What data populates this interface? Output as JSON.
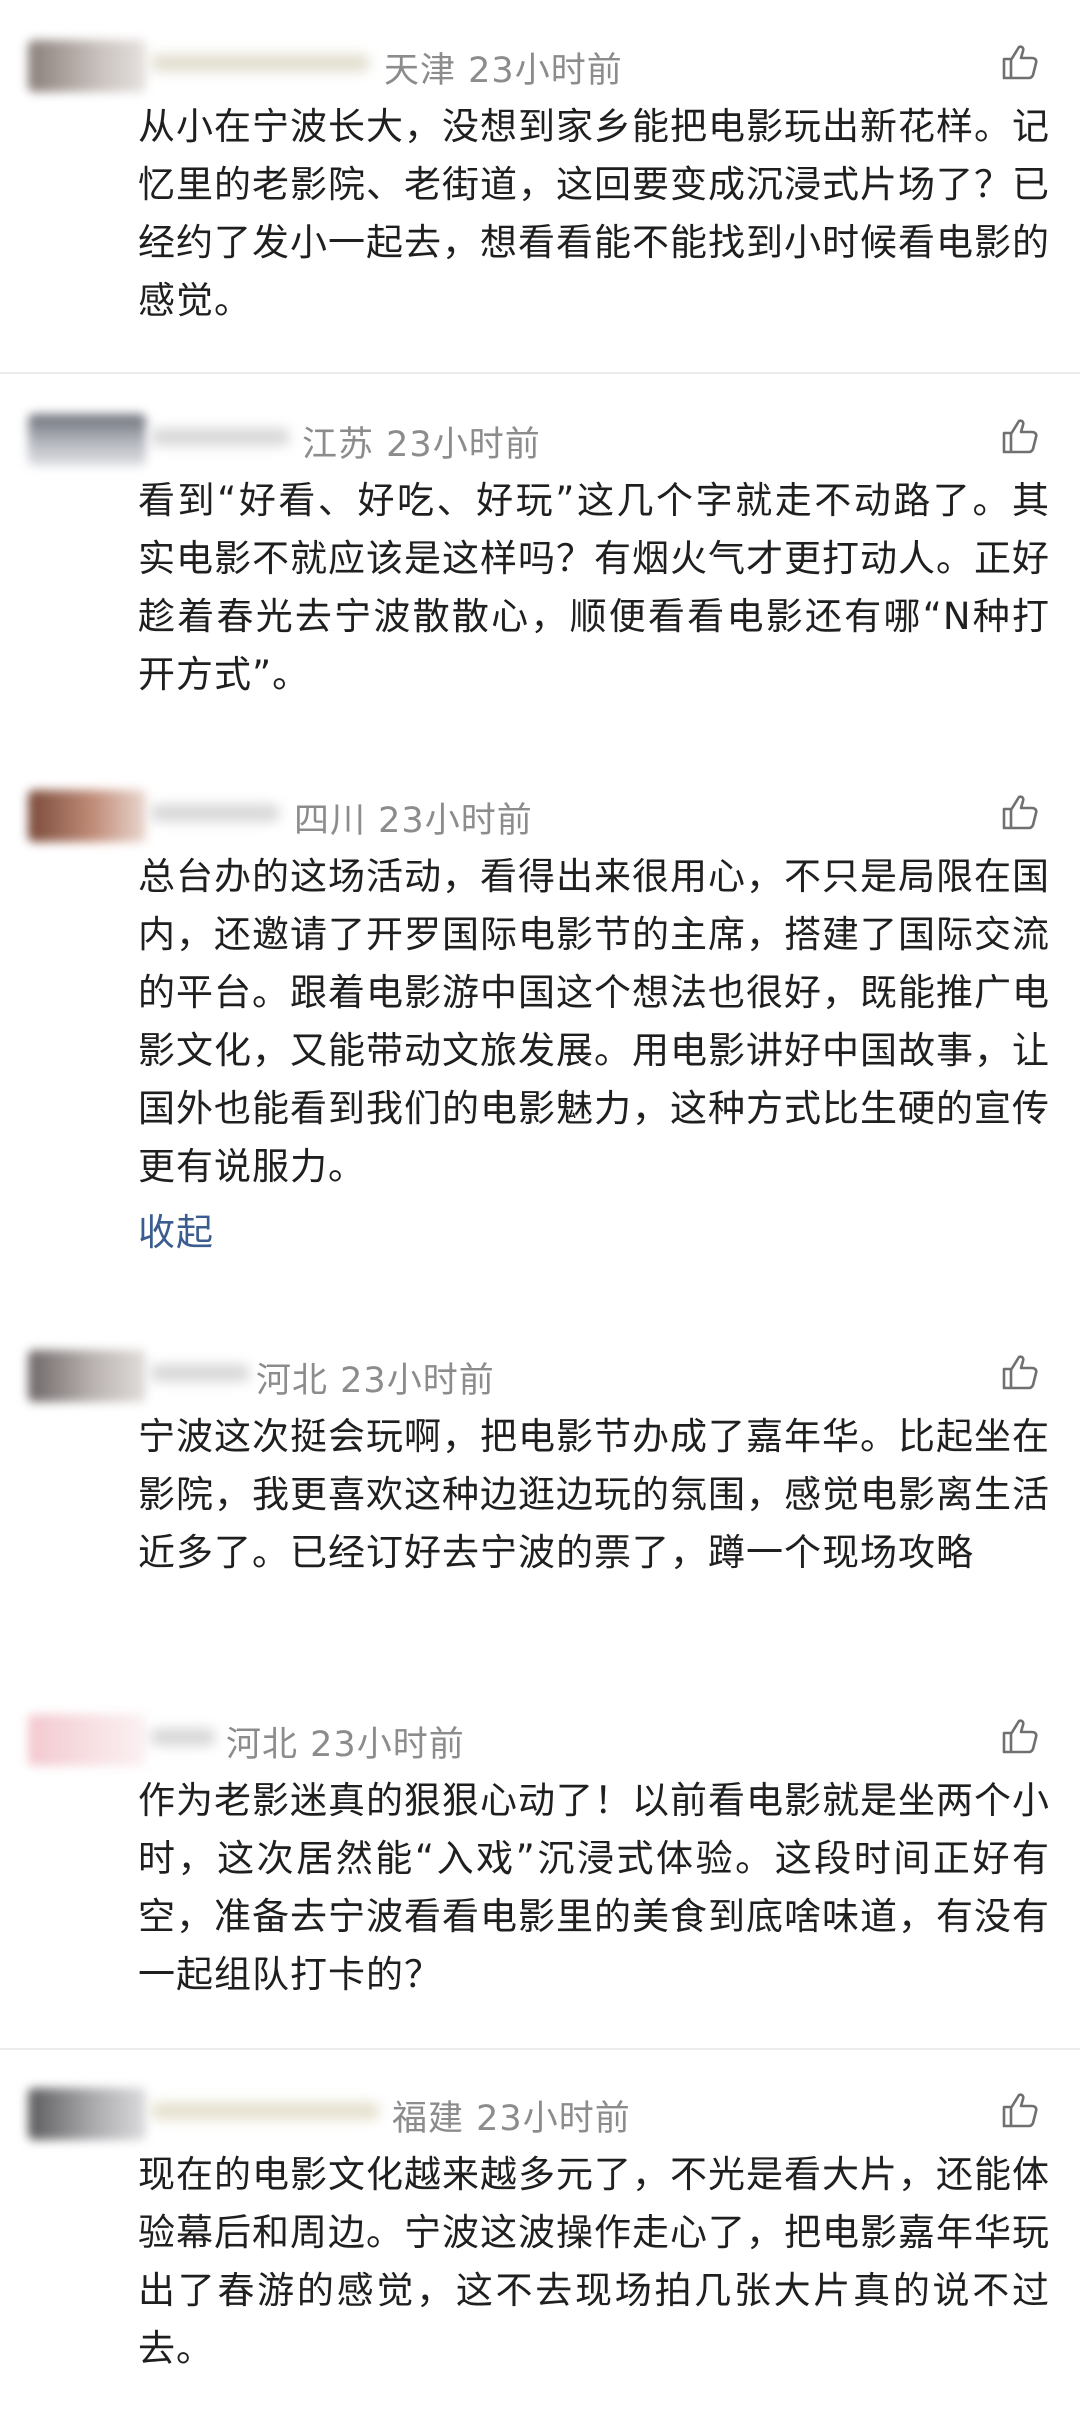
{
  "comments": [
    {
      "location": "天津",
      "time": "23小时前",
      "text": "从小在宁波长大，没想到家乡能把电影玩出新花样。记忆里的老影院、老街道，这回要变成沉浸式片场了？已经约了发小一起去，想看看能不能找到小时候看电影的感觉。"
    },
    {
      "location": "江苏",
      "time": "23小时前",
      "text": "看到“好看、好吃、好玩”这几个字就走不动路了。其实电影不就应该是这样吗？有烟火气才更打动人。正好趁着春光去宁波散散心，顺便看看电影还有哪“N种打开方式”。"
    },
    {
      "location": "四川",
      "time": "23小时前",
      "text": "总台办的这场活动，看得出来很用心，不只是局限在国内，还邀请了开罗国际电影节的主席，搭建了国际交流的平台。跟着电影游中国这个想法也很好，既能推广电影文化，又能带动文旅发展。用电影讲好中国故事，让国外也能看到我们的电影魅力，这种方式比生硬的宣传更有说服力。",
      "collapse_label": "收起"
    },
    {
      "location": "河北",
      "time": "23小时前",
      "text": "宁波这次挺会玩啊，把电影节办成了嘉年华。比起坐在影院，我更喜欢这种边逛边玩的氛围，感觉电影离生活近多了。已经订好去宁波的票了，蹲一个现场攻略"
    },
    {
      "location": "河北",
      "time": "23小时前",
      "text": "作为老影迷真的狠狠心动了！以前看电影就是坐两个小时，这次居然能“入戏”沉浸式体验。这段时间正好有空，准备去宁波看看电影里的美食到底啥味道，有没有一起组队打卡的？"
    },
    {
      "location": "福建",
      "time": "23小时前",
      "text": "现在的电影文化越来越多元了，不光是看大片，还能体验幕后和周边。宁波这波操作走心了，把电影嘉年华玩出了春游的感觉，这不去现场拍几张大片真的说不过去。"
    }
  ],
  "icons": {
    "like": "thumbs-up-icon"
  },
  "colors": {
    "meta": "#8c8c8c",
    "text": "#1f1f1f",
    "link": "#3b5c8f"
  }
}
